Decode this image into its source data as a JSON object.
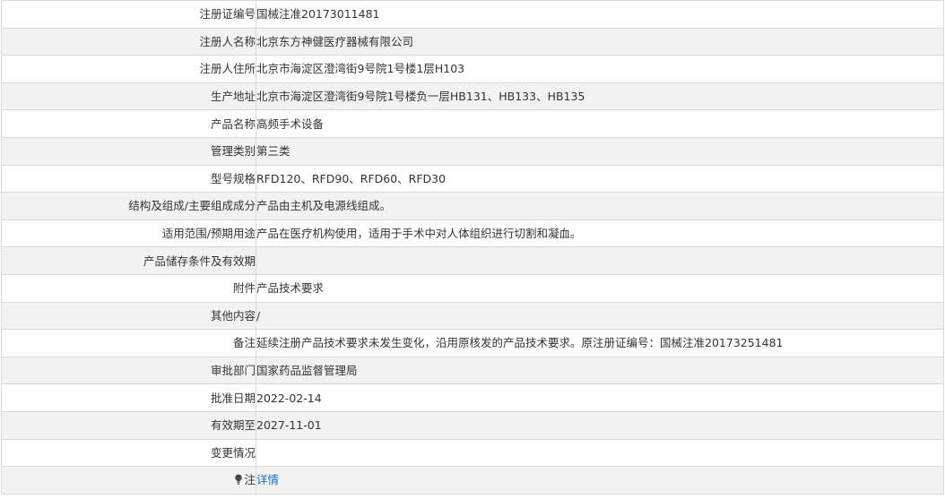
{
  "rows": [
    {
      "label": "注册证编号",
      "value": "国械注准20173011481"
    },
    {
      "label": "注册人名称",
      "value": "北京东方神健医疗器械有限公司"
    },
    {
      "label": "注册人住所",
      "value": "北京市海淀区澄湾街9号院1号楼1层H103"
    },
    {
      "label": "生产地址",
      "value": "北京市海淀区澄湾街9号院1号楼负一层HB131、HB133、HB135"
    },
    {
      "label": "产品名称",
      "value": "高频手术设备"
    },
    {
      "label": "管理类别",
      "value": "第三类"
    },
    {
      "label": "型号规格",
      "value": "RFD120、RFD90、RFD60、RFD30"
    },
    {
      "label": "结构及组成/主要组成成分",
      "value": "产品由主机及电源线组成。"
    },
    {
      "label": "适用范围/预期用途",
      "value": "产品在医疗机构使用，适用于手术中对人体组织进行切割和凝血。"
    },
    {
      "label": "产品储存条件及有效期",
      "value": ""
    },
    {
      "label": "附件",
      "value": "产品技术要求"
    },
    {
      "label": "其他内容",
      "value": "/"
    },
    {
      "label": "备注",
      "value": "延续注册产品技术要求未发生变化，沿用原核发的产品技术要求。原注册证编号：国械注准20173251481"
    },
    {
      "label": "审批部门",
      "value": "国家药品监督管理局"
    },
    {
      "label": "批准日期",
      "value": "2022-02-14"
    },
    {
      "label": "有效期至",
      "value": "2027-11-01"
    },
    {
      "label": "变更情况",
      "value": ""
    }
  ],
  "note_row": {
    "label": "注",
    "icon": "bulb-icon",
    "link_text": "详情",
    "link_color": "#1d6fb8"
  }
}
